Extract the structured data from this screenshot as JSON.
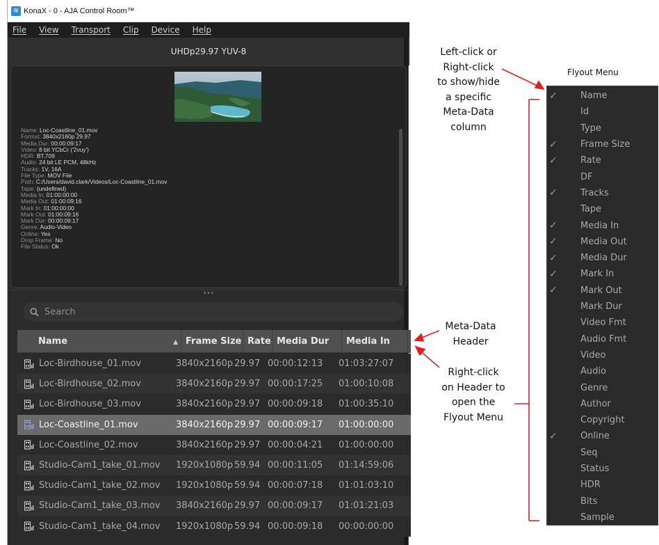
{
  "window": {
    "title": "KonaX - 0 - AJA Control Room™",
    "menus": [
      "File",
      "View",
      "Transport",
      "Clip",
      "Device",
      "Help"
    ],
    "format": "UHDp29.97 YUV-8"
  },
  "clip_info": [
    {
      "k": "Name:",
      "v": "Loc-Coastline_01.mov"
    },
    {
      "k": "Format:",
      "v": "3840x2160p 29.97"
    },
    {
      "k": "Media Dur:",
      "v": "00:00:09:17"
    },
    {
      "k": "Video:",
      "v": "8 bit YCbCr ('2vuy')"
    },
    {
      "k": "HDR:",
      "v": "BT.709"
    },
    {
      "k": "Audio:",
      "v": "24 bit LE PCM, 48kHz"
    },
    {
      "k": "Tracks:",
      "v": "1V, 16A"
    },
    {
      "k": "File Type:",
      "v": "MOV File"
    },
    {
      "k": "Path:",
      "v": "C:/Users/david.clark/Videos/Loc-Coastline_01.mov"
    },
    {
      "k": "Tape:",
      "v": "(undefined)"
    },
    {
      "k": "Media In:",
      "v": "01:00:00:00"
    },
    {
      "k": "Media Out:",
      "v": "01:00:09:16"
    },
    {
      "k": "Mark In:",
      "v": "01:00:00:00"
    },
    {
      "k": "Mark Out:",
      "v": "01:00:09:16"
    },
    {
      "k": "Mark Dur:",
      "v": "00:00:09:17"
    },
    {
      "k": "Genre:",
      "v": "Audio-Video"
    },
    {
      "k": "Online:",
      "v": "Yes"
    },
    {
      "k": "Drop Frame:",
      "v": "No"
    },
    {
      "k": "File Status:",
      "v": "Ok"
    }
  ],
  "splitter_glyph": "•••",
  "search": {
    "placeholder": "Search",
    "icon": "search-icon"
  },
  "table": {
    "columns": [
      "Name",
      "Frame Size",
      "Rate",
      "Media Dur",
      "Media In"
    ],
    "sort_glyph": "▲",
    "selected_row": 3,
    "rows": [
      [
        "Loc-Birdhouse_01.mov",
        "3840x2160p",
        "29.97",
        "00:00:12:13",
        "01:03:27:07"
      ],
      [
        "Loc-Birdhouse_02.mov",
        "3840x2160p",
        "29.97",
        "00:00:17:25",
        "01:00:10:08"
      ],
      [
        "Loc-Birdhouse_03.mov",
        "3840x2160p",
        "29.97",
        "00:00:09:18",
        "01:00:35:10"
      ],
      [
        "Loc-Coastline_01.mov",
        "3840x2160p",
        "29.97",
        "00:00:09:17",
        "01:00:00:00"
      ],
      [
        "Loc-Coastline_02.mov",
        "3840x2160p",
        "29.97",
        "00:00:04:21",
        "01:00:00:00"
      ],
      [
        "Studio-Cam1_take_01.mov",
        "1920x1080p",
        "59.94",
        "00:00:11:05",
        "01:14:59:06"
      ],
      [
        "Studio-Cam1_take_02.mov",
        "1920x1080p",
        "59.94",
        "00:00:07:18",
        "01:01:03:10"
      ],
      [
        "Studio-Cam1_take_03.mov",
        "3840x2160p",
        "29.97",
        "00:00:09:17",
        "01:01:21:03"
      ],
      [
        "Studio-Cam1_take_04.mov",
        "1920x1080p",
        "59.94",
        "00:00:09:18",
        "00:00:00:00"
      ]
    ]
  },
  "annotations": {
    "left_click": [
      "Left-click or",
      "Right-click",
      "to show/hide",
      "a specific",
      "Meta-Data",
      "column"
    ],
    "meta_header": [
      "Meta-Data",
      "Header"
    ],
    "right_click": [
      "Right-click",
      "on Header to",
      "open the",
      "Flyout Menu"
    ],
    "flyout_title": "Flyout Menu"
  },
  "flyout": {
    "check_glyph": "✓",
    "items": [
      {
        "label": "Name",
        "checked": true
      },
      {
        "label": "Id",
        "checked": false
      },
      {
        "label": "Type",
        "checked": false
      },
      {
        "label": "Frame Size",
        "checked": true
      },
      {
        "label": "Rate",
        "checked": true
      },
      {
        "label": "DF",
        "checked": false
      },
      {
        "label": "Tracks",
        "checked": true
      },
      {
        "label": "Tape",
        "checked": false
      },
      {
        "label": "Media In",
        "checked": true
      },
      {
        "label": "Media Out",
        "checked": true
      },
      {
        "label": "Media Dur",
        "checked": true
      },
      {
        "label": "Mark In",
        "checked": true
      },
      {
        "label": "Mark Out",
        "checked": true
      },
      {
        "label": "Mark Dur",
        "checked": false
      },
      {
        "label": "Video Fmt",
        "checked": false
      },
      {
        "label": "Audio Fmt",
        "checked": false
      },
      {
        "label": "Video",
        "checked": false
      },
      {
        "label": "Audio",
        "checked": false
      },
      {
        "label": "Genre",
        "checked": false
      },
      {
        "label": "Author",
        "checked": false
      },
      {
        "label": "Copyright",
        "checked": false
      },
      {
        "label": "Online",
        "checked": true
      },
      {
        "label": "Seq",
        "checked": false
      },
      {
        "label": "Status",
        "checked": false
      },
      {
        "label": "HDR",
        "checked": false
      },
      {
        "label": "Bits",
        "checked": false
      },
      {
        "label": "Sample",
        "checked": false
      }
    ]
  },
  "colors": {
    "accent_red": "#e02020",
    "selected_row": "#6a6a6a",
    "panel": "#2b2b2b"
  }
}
